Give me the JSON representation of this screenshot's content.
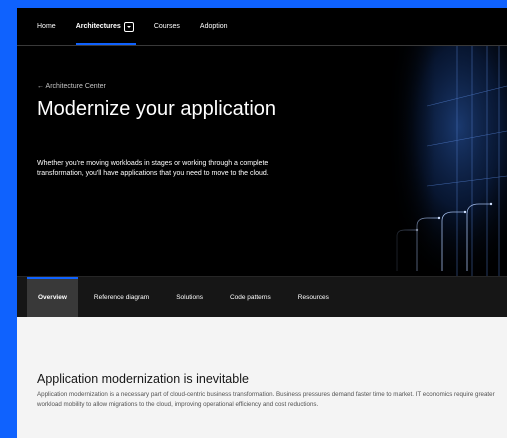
{
  "nav": {
    "items": [
      {
        "label": "Home",
        "active": false
      },
      {
        "label": "Architectures",
        "active": true,
        "dropdown": true
      },
      {
        "label": "Courses",
        "active": false
      },
      {
        "label": "Adoption",
        "active": false
      }
    ]
  },
  "hero": {
    "breadcrumb": "← Architecture Center",
    "title": "Modernize your application",
    "description": "Whether you're moving workloads in stages or working through a complete transformation, you'll have applications that you need to move to the cloud."
  },
  "tabs": [
    {
      "label": "Overview",
      "active": true
    },
    {
      "label": "Reference diagram",
      "active": false
    },
    {
      "label": "Solutions",
      "active": false
    },
    {
      "label": "Code patterns",
      "active": false
    },
    {
      "label": "Resources",
      "active": false
    }
  ],
  "section": {
    "title": "Application modernization is inevitable",
    "body": "Application modernization is a necessary part of cloud-centric business transformation. Business pressures demand faster time to market. IT economics require greater workload mobility to allow migrations to the cloud, improving operational efficiency and cost reductions."
  },
  "colors": {
    "accent": "#0f62fe",
    "background_outer": "#0f62fe",
    "hero_bg": "#000000",
    "tabbar_bg": "#161616",
    "tab_active_bg": "#393939",
    "content_bg": "#f4f4f4"
  }
}
